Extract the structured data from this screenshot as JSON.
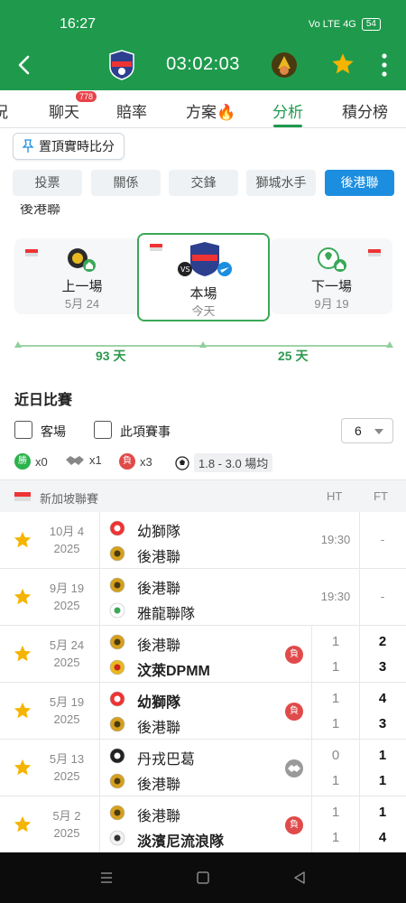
{
  "status": {
    "time": "16:27",
    "signal": "Vo LTE 4G",
    "battery": "54"
  },
  "header": {
    "match_clock": "03:02:03"
  },
  "tabs": [
    {
      "label": "況"
    },
    {
      "label": "聊天",
      "badge": "778"
    },
    {
      "label": "賠率"
    },
    {
      "label": "方案🔥"
    },
    {
      "label": "分析",
      "active": true
    },
    {
      "label": "積分榜"
    }
  ],
  "pin_button": {
    "label": "置頂實時比分"
  },
  "sub_tabs": [
    {
      "label": "投票"
    },
    {
      "label": "關係"
    },
    {
      "label": "交鋒"
    },
    {
      "label": "獅城水手"
    },
    {
      "label": "後港聯",
      "active": true
    }
  ],
  "schedule": {
    "section_title_cut": "後港聯",
    "prev": {
      "label": "上一場",
      "date": "5月 24"
    },
    "current": {
      "label": "本場",
      "date": "今天"
    },
    "next": {
      "label": "下一場",
      "date": "9月 19"
    },
    "days_before": "93 天",
    "days_after": "25 天"
  },
  "recent": {
    "title": "近日比賽",
    "filter_away": "客場",
    "filter_competition": "此項賽事",
    "count_select": "6",
    "stats": {
      "win_icon": "勝",
      "win": "x0",
      "draw": "x1",
      "loss_icon": "負",
      "loss": "x3",
      "goal_range": "1.8 - 3.0 場均"
    }
  },
  "league": {
    "name": "新加坡聯賽",
    "ht_header": "HT",
    "ft_header": "FT"
  },
  "matches": [
    {
      "date": "10月 4",
      "year": "2025",
      "home": "幼獅隊",
      "away": "後港聯",
      "time": "19:30",
      "ft": "-"
    },
    {
      "date": "9月 19",
      "year": "2025",
      "home": "後港聯",
      "away": "雅龍聯隊",
      "time": "19:30",
      "ft": "-"
    },
    {
      "date": "5月 24",
      "year": "2025",
      "home": "後港聯",
      "away": "汶萊DPMM",
      "result": "負",
      "ht_home": "1",
      "ht_away": "1",
      "ft_home": "2",
      "ft_away": "3"
    },
    {
      "date": "5月 19",
      "year": "2025",
      "home": "幼獅隊",
      "away": "後港聯",
      "result": "負",
      "ht_home": "1",
      "ht_away": "1",
      "ft_home": "4",
      "ft_away": "3"
    },
    {
      "date": "5月 13",
      "year": "2025",
      "home": "丹戎巴葛",
      "away": "後港聯",
      "result": "draw",
      "ht_home": "0",
      "ht_away": "1",
      "ft_home": "1",
      "ft_away": "1"
    },
    {
      "date": "5月 2",
      "year": "2025",
      "home": "後港聯",
      "away": "淡濱尼流浪隊",
      "result": "負",
      "ht_home": "1",
      "ht_away": "1",
      "ft_home": "1",
      "ft_away": "4"
    }
  ],
  "colors": {
    "brand_green": "#1f9a4d",
    "active_blue": "#1c8ee0",
    "loss_red": "#e04a4a",
    "win_green": "#2bb24c",
    "star": "#f4b400"
  }
}
